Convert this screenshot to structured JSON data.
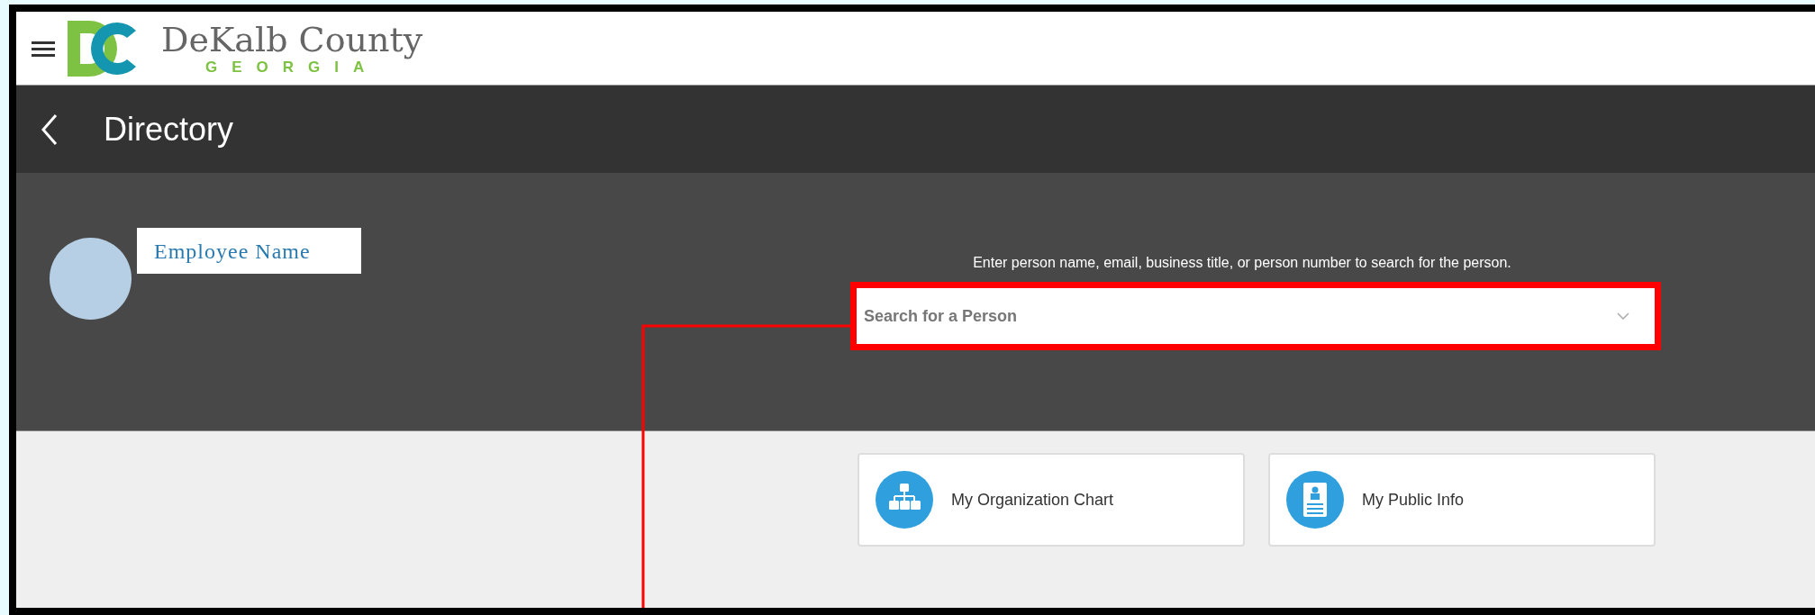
{
  "header": {
    "brand_name": "DeKalb County",
    "brand_sub": "GEORGIA"
  },
  "page_title": "Directory",
  "profile": {
    "name": "Employee Name"
  },
  "search": {
    "hint": "Enter person name, email, business title, or person number to search for the person.",
    "placeholder": "Search for a Person"
  },
  "cards": [
    {
      "kind": "org-chart",
      "label": "My Organization Chart"
    },
    {
      "kind": "public-info",
      "label": "My Public Info"
    }
  ]
}
